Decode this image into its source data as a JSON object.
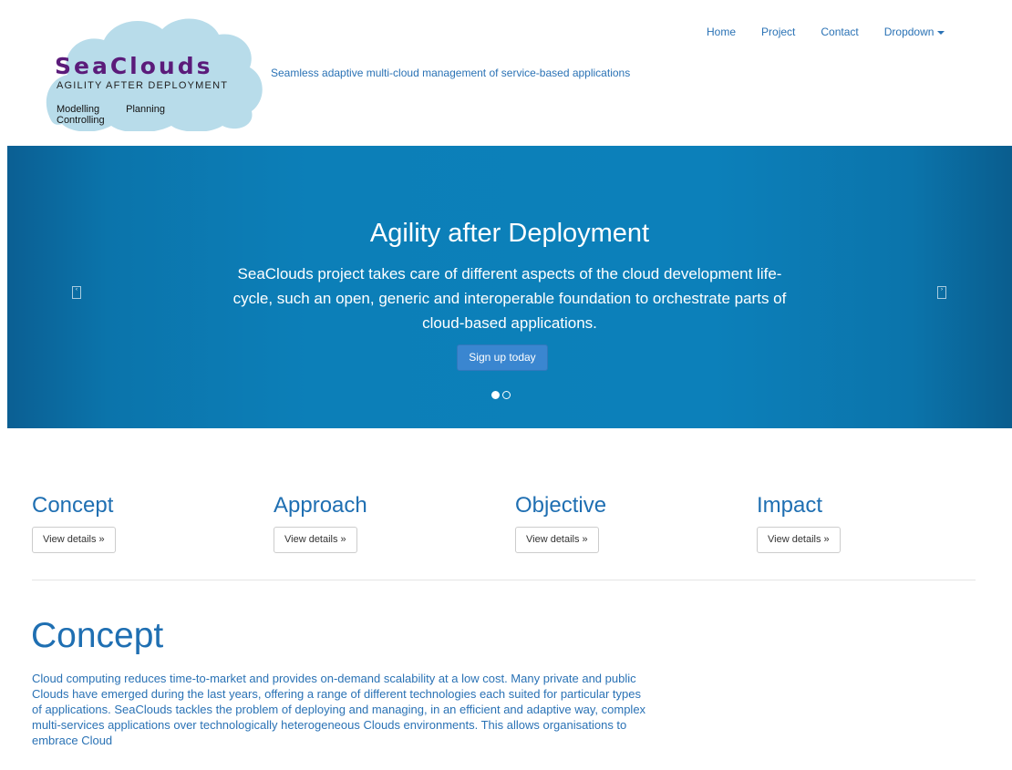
{
  "header": {
    "logo": {
      "title": "SeaClouds",
      "subtitle": "Agility After Deployment",
      "pillars": [
        "Modelling",
        "Planning",
        "Controlling"
      ]
    },
    "tagline": "Seamless adaptive multi-cloud management of service-based applications",
    "nav": [
      "Home",
      "Project",
      "Contact",
      "Dropdown"
    ]
  },
  "carousel": {
    "heading": "Agility after Deployment",
    "text": "SeaClouds project takes care of different aspects of the cloud development life-cycle, such an open, generic and interoperable foundation to orchestrate parts of cloud-based applications.",
    "button": "Sign up today",
    "prev_icon": "chevron-left-icon",
    "next_icon": "chevron-right-icon",
    "slide_count": 2,
    "active_slide": 1
  },
  "features": [
    {
      "title": "Concept",
      "button": "View details »"
    },
    {
      "title": "Approach",
      "button": "View details »"
    },
    {
      "title": "Objective",
      "button": "View details »"
    },
    {
      "title": "Impact",
      "button": "View details »"
    }
  ],
  "concept": {
    "title": "Concept",
    "text": "Cloud computing reduces time-to-market and provides on-demand scalability at a low cost. Many private and public Clouds have emerged during the last years, offering a range of different technologies each suited for particular types of applications. SeaClouds tackles the problem of deploying and managing, in an efficient and adaptive way, complex multi-services applications over technologically heterogeneous Clouds environments. This allows organisations to embrace Cloud"
  },
  "colors": {
    "link": "#2a72b5",
    "heading": "#1f6fb2",
    "carousel_bg": "#0c80ba",
    "button_primary": "#3a86d0",
    "logo_cloud": "#b8dcea",
    "logo_text": "#5b1b7a"
  }
}
